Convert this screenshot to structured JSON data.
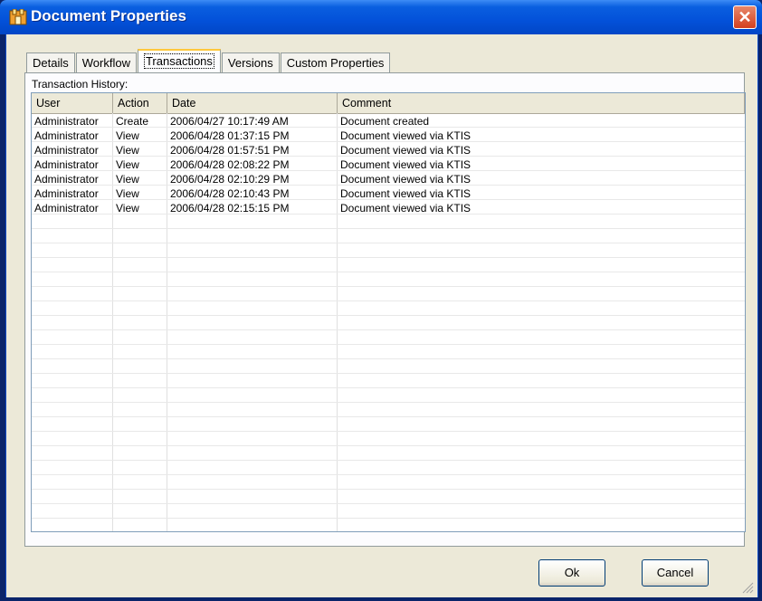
{
  "window": {
    "title": "Document Properties",
    "close_label": "✕"
  },
  "tabs": [
    {
      "label": "Details",
      "active": false
    },
    {
      "label": "Workflow",
      "active": false
    },
    {
      "label": "Transactions",
      "active": true
    },
    {
      "label": "Versions",
      "active": false
    },
    {
      "label": "Custom Properties",
      "active": false
    }
  ],
  "history": {
    "label": "Transaction History:",
    "columns": [
      "User",
      "Action",
      "Date",
      "Comment"
    ],
    "rows": [
      [
        "Administrator",
        "Create",
        "2006/04/27 10:17:49 AM",
        "Document created"
      ],
      [
        "Administrator",
        "View",
        "2006/04/28 01:37:15 PM",
        "Document viewed via KTIS"
      ],
      [
        "Administrator",
        "View",
        "2006/04/28 01:57:51 PM",
        "Document viewed via KTIS"
      ],
      [
        "Administrator",
        "View",
        "2006/04/28 02:08:22 PM",
        "Document viewed via KTIS"
      ],
      [
        "Administrator",
        "View",
        "2006/04/28 02:10:29 PM",
        "Document viewed via KTIS"
      ],
      [
        "Administrator",
        "View",
        "2006/04/28 02:10:43 PM",
        "Document viewed via KTIS"
      ],
      [
        "Administrator",
        "View",
        "2006/04/28 02:15:15 PM",
        "Document viewed via KTIS"
      ]
    ]
  },
  "buttons": {
    "ok_label": "Ok",
    "cancel_label": "Cancel"
  },
  "colors": {
    "titlebar": "#0351d9",
    "close": "#d4401f",
    "dialog_bg": "#ece9d8",
    "active_tab_accent": "#ffc83c"
  },
  "icons": {
    "app": "document-properties-icon",
    "close": "close-icon",
    "grip": "resize-grip-icon"
  }
}
